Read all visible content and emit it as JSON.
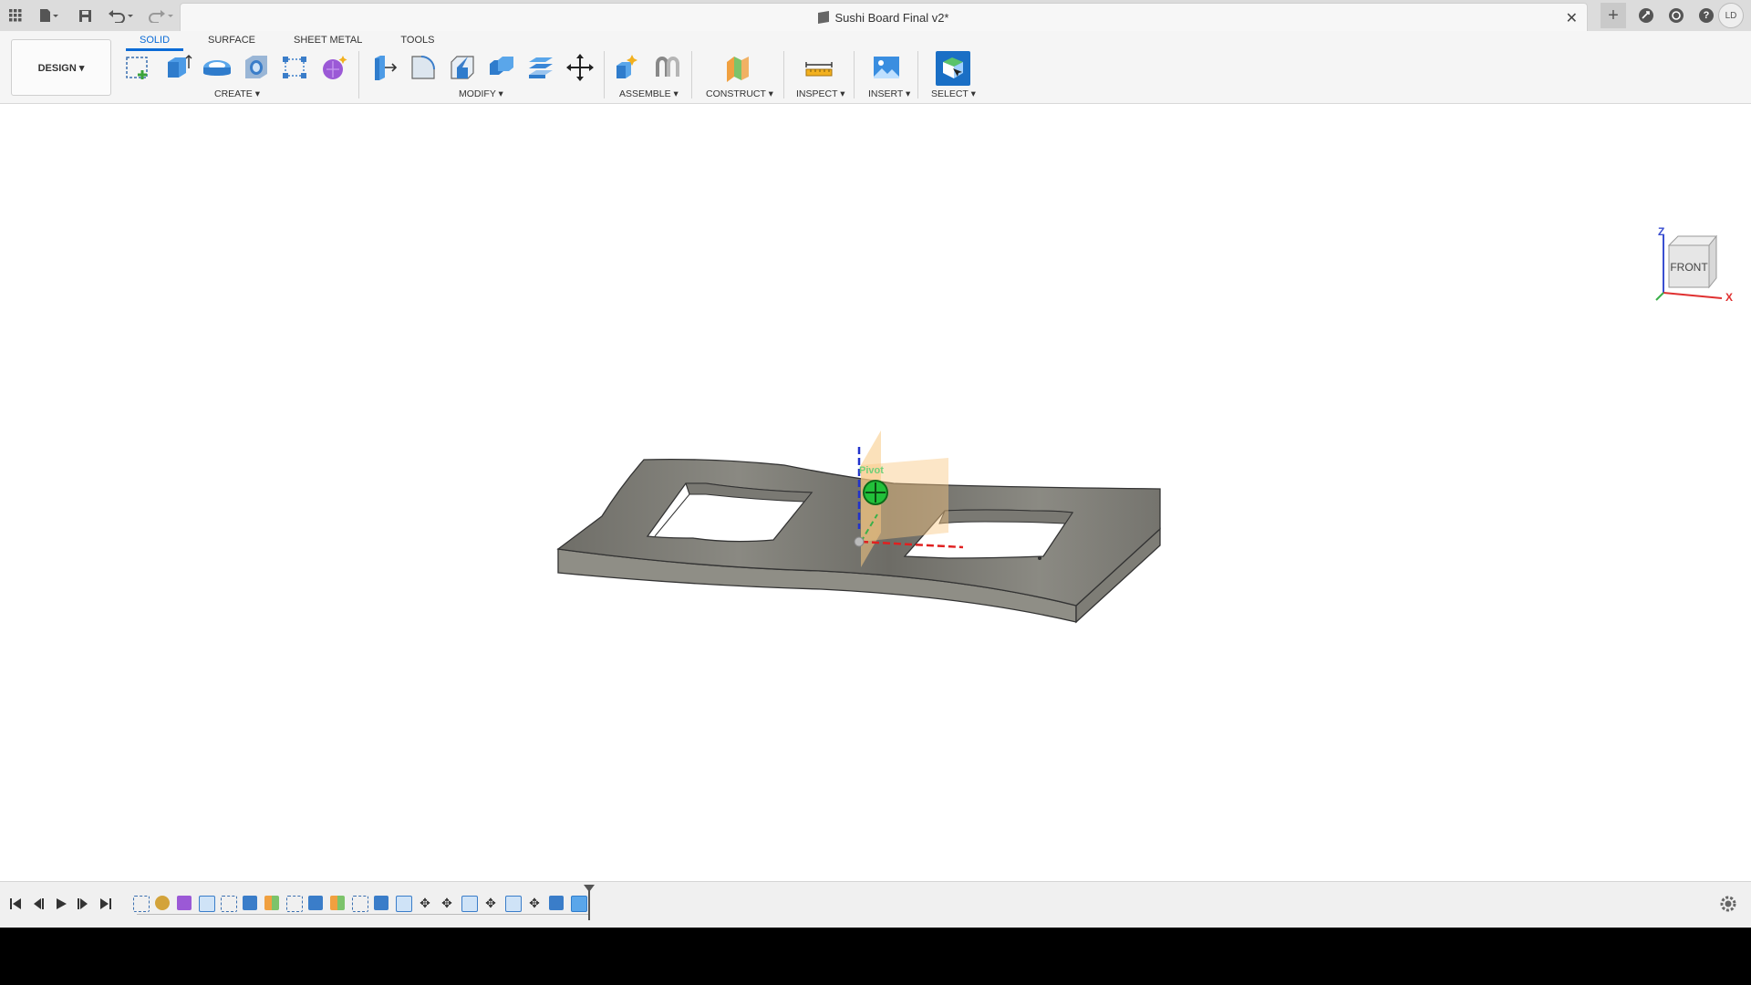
{
  "window": {
    "doc_title": "Sushi Board Final v2*",
    "user_initials": "LD"
  },
  "toolbar": {
    "workspace_label": "DESIGN ▾",
    "tabs": [
      {
        "label": "SOLID",
        "active": true
      },
      {
        "label": "SURFACE",
        "active": false
      },
      {
        "label": "SHEET METAL",
        "active": false
      },
      {
        "label": "TOOLS",
        "active": false
      }
    ],
    "groups": {
      "create": "CREATE ▾",
      "modify": "MODIFY ▾",
      "assemble": "ASSEMBLE ▾",
      "construct": "CONSTRUCT ▾",
      "inspect": "INSPECT ▾",
      "insert": "INSERT ▾",
      "select": "SELECT ▾"
    }
  },
  "viewport": {
    "viewcube_face": "FRONT",
    "axis_z": "Z",
    "axis_x": "X",
    "pivot_label": "Pivot"
  },
  "colors": {
    "accent": "#0b6bd6",
    "model_top": "#7b7a74",
    "model_side": "#8c8b83",
    "plane": "#f8c882"
  }
}
